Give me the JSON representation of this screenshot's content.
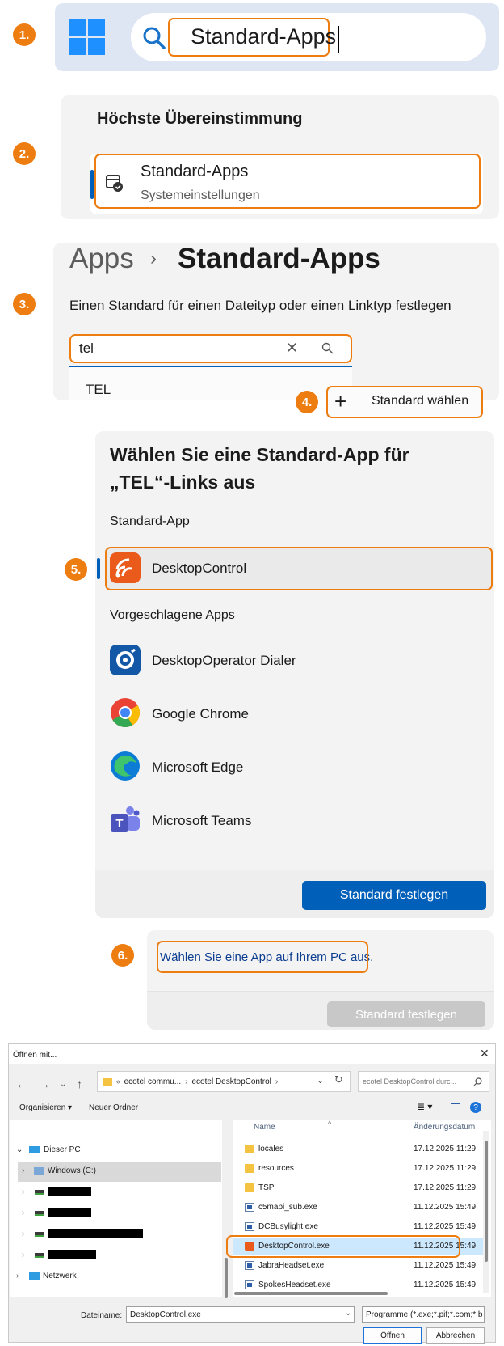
{
  "steps": [
    "1.",
    "2.",
    "3.",
    "4.",
    "5.",
    "6."
  ],
  "accent_color": "#ee7d11",
  "windows_blue": "#005fb8",
  "taskbar_search": {
    "query": "Standard-Apps"
  },
  "search_results": {
    "heading": "Höchste Übereinstimmung",
    "best_match": {
      "name": "Standard-Apps",
      "subtitle": "Systemeinstellungen"
    }
  },
  "settings": {
    "breadcrumb_parent": "Apps",
    "breadcrumb_separator": "›",
    "page_title": "Standard-Apps",
    "filetype_label": "Einen Standard für einen Dateityp oder einen Linktyp festlegen",
    "filetype_query": "tel",
    "suggestion": "TEL",
    "choose_default_button": "Standard wählen"
  },
  "chooser": {
    "title": "Wählen Sie eine Standard-App für „TEL“-Links aus",
    "default_section": "Standard-App",
    "default_app": "DesktopControl",
    "suggested_section": "Vorgeschlagene Apps",
    "suggested_apps": [
      "DesktopOperator Dialer",
      "Google Chrome",
      "Microsoft Edge",
      "Microsoft Teams"
    ],
    "set_default_button": "Standard festlegen"
  },
  "choose_pc_app": {
    "link": "Wählen Sie eine App auf Ihrem PC aus.",
    "set_default_button": "Standard festlegen"
  },
  "open_with_dialog": {
    "title": "Öffnen mit...",
    "address_parts": [
      "«",
      "ecotel commu...",
      "›",
      "ecotel DesktopControl",
      "›"
    ],
    "search_placeholder": "ecotel DesktopControl durc...",
    "toolbar_organize": "Organisieren ▾",
    "toolbar_new_folder": "Neuer Ordner",
    "tree": {
      "this_pc": "Dieser PC",
      "drive": "Windows (C:)",
      "network": "Netzwerk"
    },
    "columns": {
      "name": "Name",
      "date": "Änderungsdatum"
    },
    "files": [
      {
        "name": "locales",
        "date": "17.12.2025 11:29",
        "kind": "folder"
      },
      {
        "name": "resources",
        "date": "17.12.2025 11:29",
        "kind": "folder"
      },
      {
        "name": "TSP",
        "date": "17.12.2025 11:29",
        "kind": "folder"
      },
      {
        "name": "c5mapi_sub.exe",
        "date": "11.12.2025 15:49",
        "kind": "exe"
      },
      {
        "name": "DCBusylight.exe",
        "date": "11.12.2025 15:49",
        "kind": "exe"
      },
      {
        "name": "DesktopControl.exe",
        "date": "11.12.2025 15:49",
        "kind": "app"
      },
      {
        "name": "JabraHeadset.exe",
        "date": "11.12.2025 15:49",
        "kind": "exe"
      },
      {
        "name": "SpokesHeadset.exe",
        "date": "11.12.2025 15:49",
        "kind": "exe"
      }
    ],
    "filename_label": "Dateiname:",
    "filename_value": "DesktopControl.exe",
    "filetype_value": "Programme (*.exe;*.pif;*.com;*.b",
    "open_button": "Öffnen",
    "cancel_button": "Abbrechen"
  }
}
